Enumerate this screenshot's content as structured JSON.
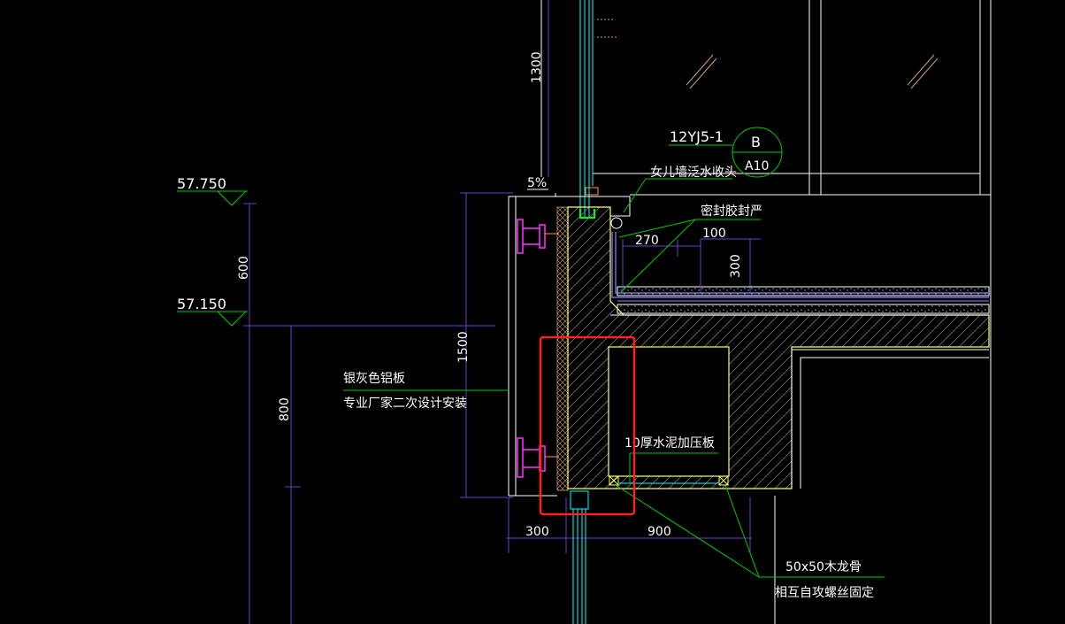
{
  "elevations": {
    "top": "57.750",
    "mid": "57.150"
  },
  "dimensions": {
    "d1300": "1300",
    "d600": "600",
    "d1500": "1500",
    "d800": "800",
    "d270": "270",
    "d100": "100",
    "d300_right": "300",
    "d300_bottom": "300",
    "d900": "900",
    "slope": "5%"
  },
  "detail_callout": {
    "ref": "12YJ5-1",
    "letter": "B",
    "sheet": "A10"
  },
  "labels": {
    "parapet_flashing": "女儿墙泛水收头",
    "sealant": "密封胶封严",
    "panel_name": "银灰色铝板",
    "panel_note": "专业厂家二次设计安装",
    "cement_board": "10厚水泥加压板",
    "wood_keel": "50x50木龙骨",
    "screw_note": "相互自攻螺丝固定"
  },
  "colors": {
    "background": "#000000",
    "leader": "#00cc00",
    "dim": "#6a3fcf",
    "concrete_outline": "#ffff66",
    "highlight": "#ff2020",
    "glass": "#00ffff",
    "bracket": "#ff33ff"
  }
}
